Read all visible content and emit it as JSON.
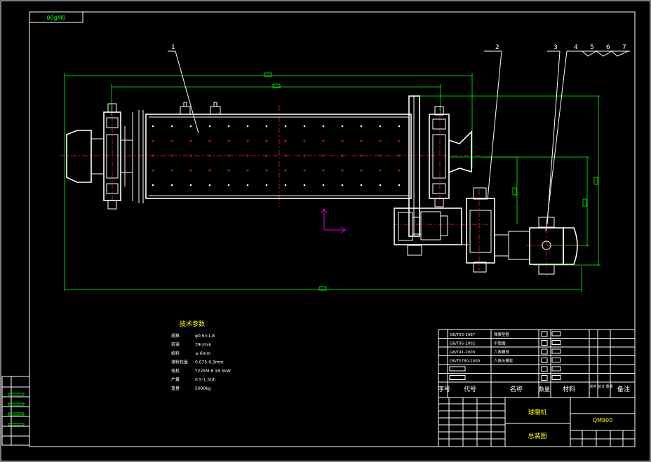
{
  "drawing_code_top": "00ɡM0",
  "callouts": [
    "1",
    "2",
    "3",
    "4",
    "5",
    "6",
    "7"
  ],
  "tech_params": {
    "title": "技术参数",
    "rows": [
      {
        "label": "规格",
        "value": "φ0.9×1.8"
      },
      {
        "label": "转速",
        "value": "39r/min"
      },
      {
        "label": "给料",
        "value": "≤ 6mm"
      },
      {
        "label": "排料粒度",
        "value": "0.075-0.3mm"
      },
      {
        "label": "电机",
        "value": "Y225M-6  18.5kW"
      },
      {
        "label": "产量",
        "value": "0.5-1.5t/h"
      },
      {
        "label": "重量",
        "value": "5000kg"
      }
    ]
  },
  "parts_list": [
    {
      "no": "",
      "code": "GB/T93-1987",
      "name": "弹簧垫圈",
      "qty": "",
      "material": ""
    },
    {
      "no": "",
      "code": "GB/T95-2002",
      "name": "平垫圈",
      "qty": "",
      "material": ""
    },
    {
      "no": "",
      "code": "GB/T41-2000",
      "name": "六角螺母",
      "qty": "",
      "material": ""
    },
    {
      "no": "",
      "code": "GB/T5780-2000",
      "name": "六角头螺栓",
      "qty": "",
      "material": ""
    },
    {
      "no": "",
      "code": "",
      "name": "",
      "qty": "",
      "material": ""
    },
    {
      "no": "",
      "code": "",
      "name": "",
      "qty": "",
      "material": ""
    }
  ],
  "header_row": {
    "no": "序号",
    "code": "代号",
    "name": "名称",
    "qty": "数量",
    "material": "材料",
    "weight": "单件 总计 重量",
    "remark": "备注"
  },
  "title_block": {
    "product_name": "球磨机",
    "drawing_name": "总装图",
    "drawing_code": "QM900"
  },
  "colors": {
    "outline": "#ffffff",
    "dimension": "#00ff00",
    "centerline": "#ff2020",
    "marker": "#e000e0",
    "text": "#ffff00"
  }
}
